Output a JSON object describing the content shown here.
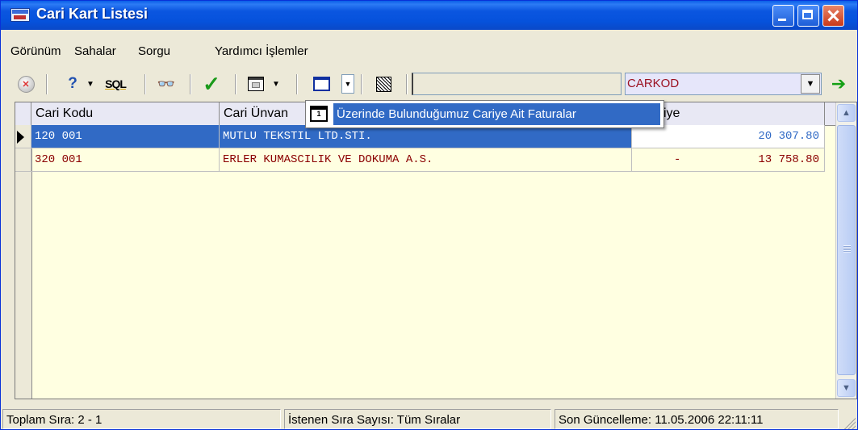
{
  "window": {
    "title": "Cari Kart Listesi"
  },
  "menu": [
    "Görünüm",
    "Sahalar",
    "Sorgu",
    "Yardımcı İşlemler"
  ],
  "toolbar": {
    "sql_label": "SQL",
    "search_value": "",
    "combo_value": "CARKOD"
  },
  "grid": {
    "columns": [
      "Cari Kodu",
      "Cari Ünvan",
      "iye"
    ],
    "rows": [
      {
        "kod": "120 001",
        "unvan": "MUTLU TEKSTIL LTD.STI.",
        "sign": "",
        "amount": "20 307.80"
      },
      {
        "kod": "320 001",
        "unvan": "ERLER KUMASCILIK VE DOKUMA A.S.",
        "sign": "-",
        "amount": "13 758.80"
      }
    ]
  },
  "popup": {
    "icon_label": "1",
    "item_label": "Üzerinde Bulunduğumuz Cariye Ait Faturalar"
  },
  "status": {
    "toplam": "Toplam Sıra: 2 - 1",
    "istenen": "İstenen Sıra Sayısı: Tüm Sıralar",
    "son": "Son Güncelleme: 11.05.2006 22:11:11"
  },
  "colors": {
    "titlebar": "#0A5FE8",
    "selection": "#316AC5",
    "grid_bg": "#FFFFE1",
    "row_text": "#8B0000",
    "combo_text": "#9B1020"
  }
}
